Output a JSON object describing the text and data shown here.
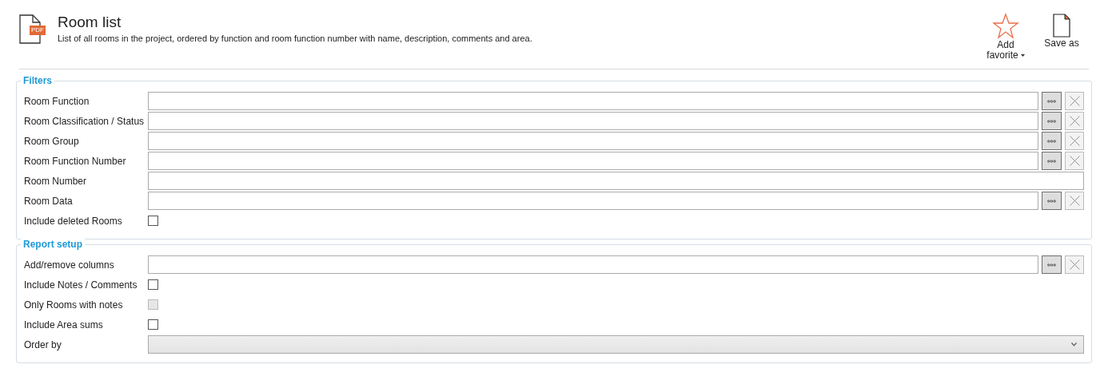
{
  "header": {
    "title": "Room list",
    "description": "List of all rooms in the project, ordered by function and room function number with name, description, comments and area.",
    "file_badge": "PDF"
  },
  "toolbar": [
    {
      "kind": "favorite",
      "label": "Add favorite",
      "has_menu": true
    },
    {
      "kind": "save",
      "label": "Save as",
      "has_menu": false
    }
  ],
  "groups": [
    {
      "title": "Filters",
      "rows": [
        {
          "kind": "picker",
          "label": "Room Function"
        },
        {
          "kind": "picker",
          "label": "Room Classification / Status"
        },
        {
          "kind": "picker",
          "label": "Room Group"
        },
        {
          "kind": "picker",
          "label": "Room Function Number"
        },
        {
          "kind": "text",
          "label": "Room Number"
        },
        {
          "kind": "picker",
          "label": "Room Data"
        },
        {
          "kind": "checkbox",
          "label": "Include deleted Rooms",
          "checked": false,
          "disabled": false
        }
      ]
    },
    {
      "title": "Report setup",
      "rows": [
        {
          "kind": "picker",
          "label": "Add/remove columns"
        },
        {
          "kind": "checkbox",
          "label": "Include Notes / Comments",
          "checked": false,
          "disabled": false
        },
        {
          "kind": "checkbox",
          "label": "Only Rooms with notes",
          "checked": false,
          "disabled": true
        },
        {
          "kind": "checkbox",
          "label": "Include Area sums",
          "checked": false,
          "disabled": false
        },
        {
          "kind": "dropdown",
          "label": "Order by"
        }
      ]
    }
  ]
}
